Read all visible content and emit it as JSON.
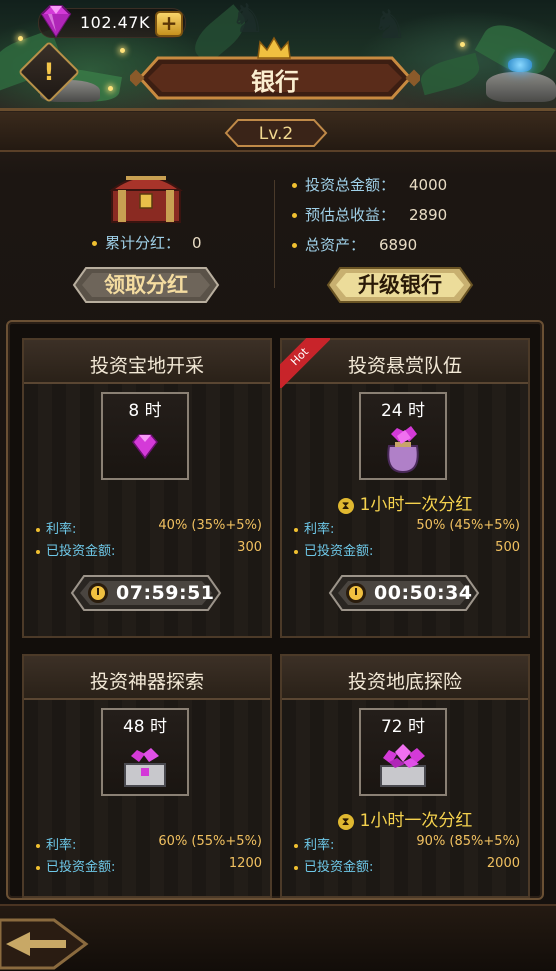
{
  "header": {
    "gem_amount": "102.47K",
    "plus_label": "+",
    "alert_label": "!",
    "title": "银行"
  },
  "bank": {
    "level": "Lv.2",
    "accumulated_dividend_label": "累计分红：",
    "accumulated_dividend_value": "0",
    "total_investment_label": "投资总金额：",
    "total_investment_value": "4000",
    "estimated_income_label": "预估总收益：",
    "estimated_income_value": "2890",
    "total_assets_label": "总资产：",
    "total_assets_value": "6890",
    "claim_button": "领取分红",
    "upgrade_button": "升级银行"
  },
  "investments": [
    {
      "title": "投资宝地开采",
      "hours": "8 时",
      "icon": "gem-icon",
      "hot": false,
      "payout": "",
      "rate_label": "利率:",
      "rate_value": "40% (35%+5%)",
      "invested_label": "已投资金额:",
      "invested_value": "300",
      "timer": "07:59:51"
    },
    {
      "title": "投资悬赏队伍",
      "hours": "24 时",
      "icon": "gem-bag-icon",
      "hot": true,
      "hot_label": "Hot",
      "payout": "1小时一次分红",
      "rate_label": "利率:",
      "rate_value": "50% (45%+5%)",
      "invested_label": "已投资金额:",
      "invested_value": "500",
      "timer": "00:50:34"
    },
    {
      "title": "投资神器探索",
      "hours": "48 时",
      "icon": "gem-chest-icon",
      "hot": false,
      "payout": "",
      "rate_label": "利率:",
      "rate_value": "60% (55%+5%)",
      "invested_label": "已投资金额:",
      "invested_value": "1200"
    },
    {
      "title": "投资地底探险",
      "hours": "72 时",
      "icon": "gem-chest-full-icon",
      "hot": false,
      "payout": "1小时一次分红",
      "rate_label": "利率:",
      "rate_value": "90% (85%+5%)",
      "invested_label": "已投资金额:",
      "invested_value": "2000"
    }
  ],
  "colors": {
    "gem": "#d43ad8",
    "gold": "#f0c040",
    "label_blue": "#6ec8e8",
    "value_orange": "#f0c060"
  }
}
